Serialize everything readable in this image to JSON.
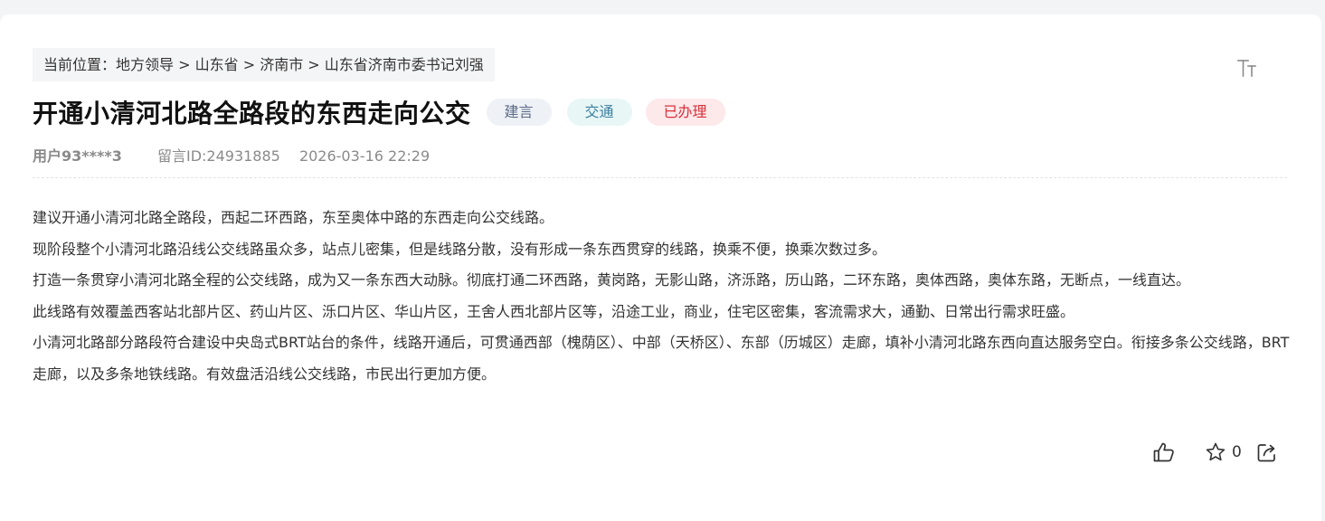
{
  "breadcrumb": {
    "prefix": "当前位置：",
    "items": [
      "地方领导",
      "山东省",
      "济南市",
      "山东省济南市委书记刘强"
    ],
    "separator": " > "
  },
  "toolbar": {
    "font_size_icon": "font-size-icon"
  },
  "message": {
    "title": "开通小清河北路全路段的东西走向公交",
    "tags": {
      "type": "建言",
      "topic": "交通",
      "status": "已办理"
    },
    "user": "用户93****3",
    "message_id": "留言ID:24931885",
    "time": "2026-03-16 22:29",
    "paragraphs": [
      "建议开通小清河北路全路段，西起二环西路，东至奥体中路的东西走向公交线路。",
      "现阶段整个小清河北路沿线公交线路虽众多，站点儿密集，但是线路分散，没有形成一条东西贯穿的线路，换乘不便，换乘次数过多。",
      "打造一条贯穿小清河北路全程的公交线路，成为又一条东西大动脉。彻底打通二环西路，黄岗路，无影山路，济泺路，历山路，二环东路，奥体西路，奥体东路，无断点，一线直达。",
      "此线路有效覆盖西客站北部片区、药山片区、泺口片区、华山片区，王舍人西北部片区等，沿途工业，商业，住宅区密集，客流需求大，通勤、日常出行需求旺盛。",
      "小清河北路部分路段符合建设中央岛式BRT站台的条件，线路开通后，可贯通西部（槐荫区）、中部（天桥区）、东部（历城区）走廊，填补小清河北路东西向直达服务空白。衔接多条公交线路，BRT走廊，以及多条地铁线路。有效盘活沿线公交线路，市民出行更加方便。"
    ]
  },
  "actions": {
    "like_icon": "thumbs-up-icon",
    "favorite_icon": "star-icon",
    "favorite_count": "0",
    "share_icon": "share-icon"
  },
  "colors": {
    "status_red": "#d8323c",
    "topic_blue": "#3a7fa0",
    "type_gray": "#5b6a85"
  }
}
